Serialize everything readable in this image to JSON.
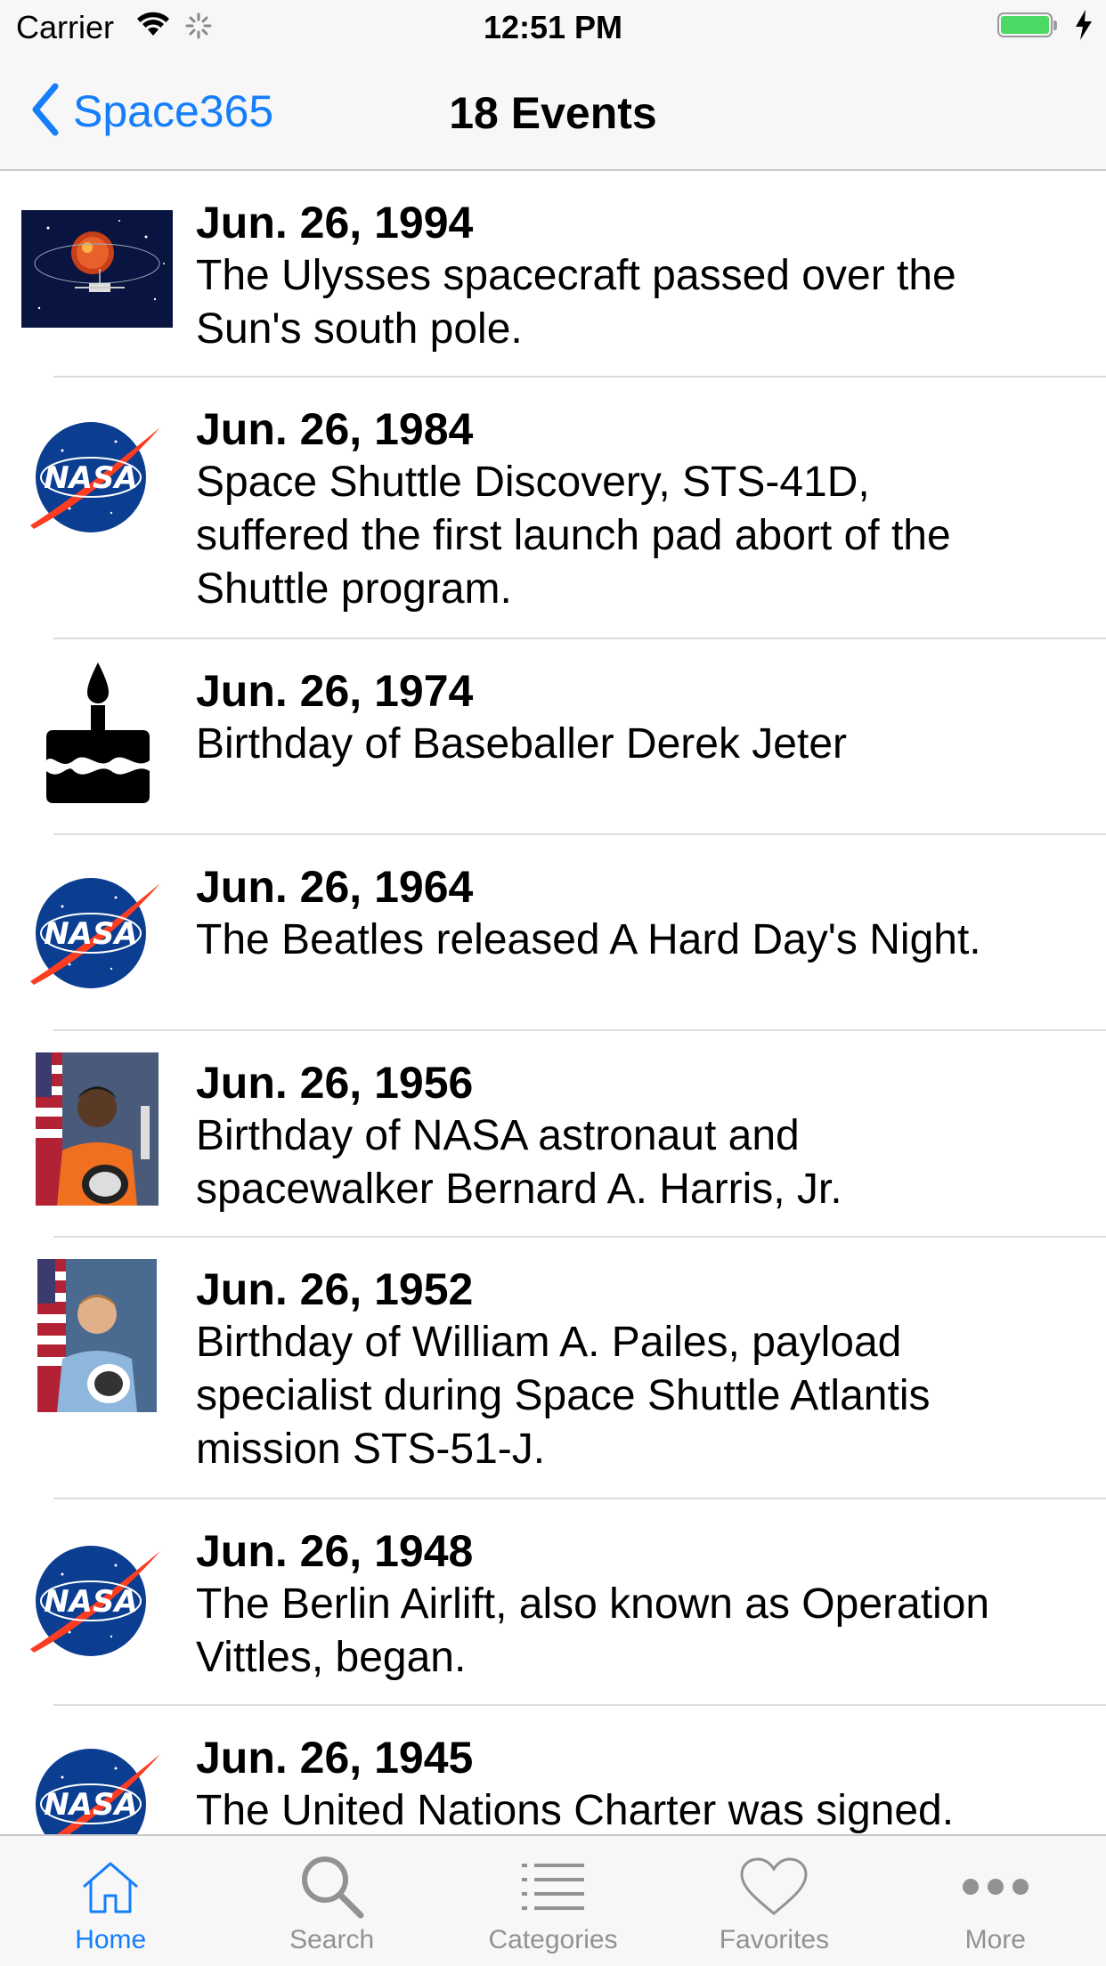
{
  "status": {
    "carrier": "Carrier",
    "time": "12:51 PM"
  },
  "nav": {
    "back_label": "Space365",
    "title": "18 Events"
  },
  "events": [
    {
      "date": "Jun. 26, 1994",
      "desc_lines": [
        "The Ulysses spacecraft passed over the",
        "Sun's south pole."
      ],
      "thumb": "ulysses-spacecraft-image"
    },
    {
      "date": "Jun. 26, 1984",
      "desc_lines": [
        "Space Shuttle Discovery, STS-41D,",
        "suffered the first launch pad abort of the",
        "Shuttle program."
      ],
      "thumb": "nasa-logo"
    },
    {
      "date": "Jun. 26, 1974",
      "desc_lines": [
        "Birthday of Baseballer Derek Jeter"
      ],
      "thumb": "birthday-cake-icon"
    },
    {
      "date": "Jun. 26, 1964",
      "desc_lines": [
        "The Beatles released A Hard Day's Night."
      ],
      "thumb": "nasa-logo"
    },
    {
      "date": "Jun. 26, 1956",
      "desc_lines": [
        "Birthday of NASA astronaut and",
        "spacewalker Bernard A. Harris, Jr."
      ],
      "thumb": "astronaut-portrait-orange"
    },
    {
      "date": "Jun. 26, 1952",
      "desc_lines": [
        "Birthday of William A. Pailes, payload",
        "specialist during Space Shuttle Atlantis",
        "mission STS-51-J."
      ],
      "thumb": "astronaut-portrait-blue"
    },
    {
      "date": "Jun. 26, 1948",
      "desc_lines": [
        "The Berlin Airlift, also known as Operation",
        "Vittles, began."
      ],
      "thumb": "nasa-logo"
    },
    {
      "date": "Jun. 26, 1945",
      "desc_lines": [
        "The United Nations Charter was signed."
      ],
      "thumb": "nasa-logo"
    }
  ],
  "tabs": [
    {
      "label": "Home",
      "icon": "home-icon",
      "active": true
    },
    {
      "label": "Search",
      "icon": "search-icon",
      "active": false
    },
    {
      "label": "Categories",
      "icon": "list-icon",
      "active": false
    },
    {
      "label": "Favorites",
      "icon": "heart-icon",
      "active": false
    },
    {
      "label": "More",
      "icon": "more-icon",
      "active": false
    }
  ],
  "colors": {
    "accent": "#157efb",
    "inactive_tab": "#929292",
    "battery": "#4cd964",
    "nasa_blue": "#0b3d91",
    "nasa_red": "#fc3d21"
  }
}
